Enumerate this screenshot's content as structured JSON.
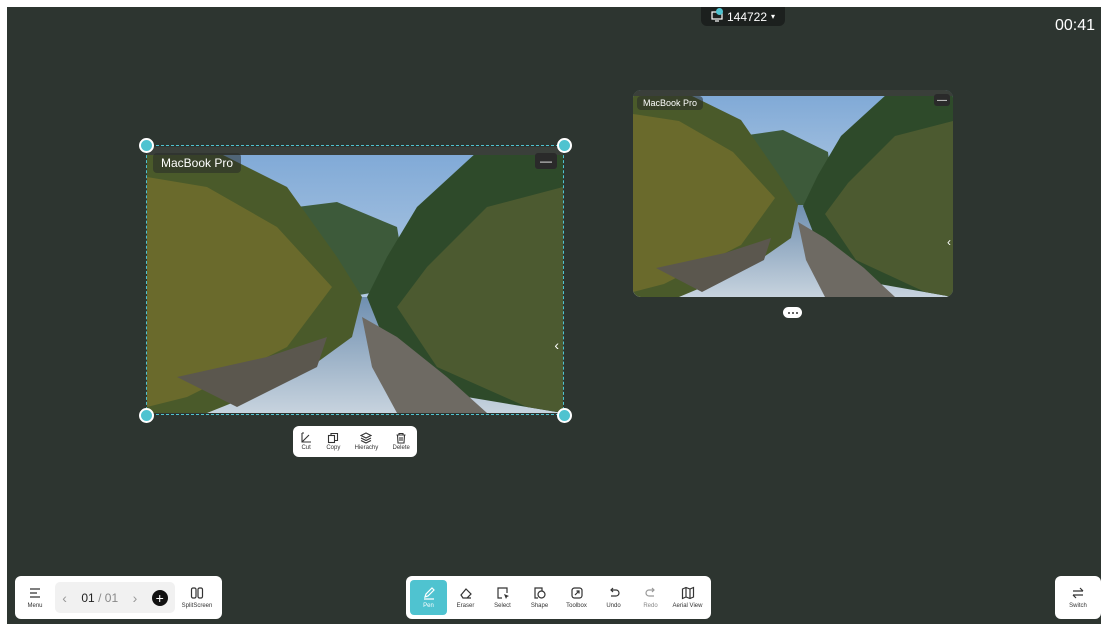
{
  "cast": {
    "code": "144722",
    "arrow": "▾"
  },
  "timer": "00:41",
  "windows": {
    "main": {
      "label": "MacBook Pro",
      "minimize": "—",
      "chevron": "‹"
    },
    "side": {
      "label": "MacBook Pro",
      "minimize": "—",
      "chevron": "‹"
    }
  },
  "context_menu": {
    "cut": "Cut",
    "copy": "Copy",
    "hierarchy": "Hierachy",
    "delete": "Delete"
  },
  "left_bar": {
    "menu": "Menu",
    "prev": "‹",
    "current_page": "01",
    "separator": "/",
    "total_pages": "01",
    "next": "›",
    "add": "+",
    "split": "SplitScreen"
  },
  "toolbar": {
    "pen": "Pen",
    "eraser": "Eraser",
    "select": "Select",
    "shape": "Shape",
    "toolbox": "Toolbox",
    "undo": "Undo",
    "redo": "Redo",
    "aerial": "Aerial View"
  },
  "right_bar": {
    "switch": "Switch"
  },
  "colors": {
    "board": "#2d3530",
    "accent": "#4fc3d0",
    "bar": "#ffffff"
  },
  "icons": {
    "menu": "menu-icon",
    "cut": "cut-icon",
    "copy": "copy-icon",
    "hierarchy": "layers-icon",
    "delete": "trash-icon",
    "pen": "pen-icon",
    "eraser": "eraser-icon",
    "select": "select-icon",
    "shape": "shape-icon",
    "toolbox": "toolbox-icon",
    "undo": "undo-icon",
    "redo": "redo-icon",
    "aerial": "map-icon",
    "split": "split-screen-icon",
    "switch": "switch-icon",
    "cast": "cast-icon"
  }
}
